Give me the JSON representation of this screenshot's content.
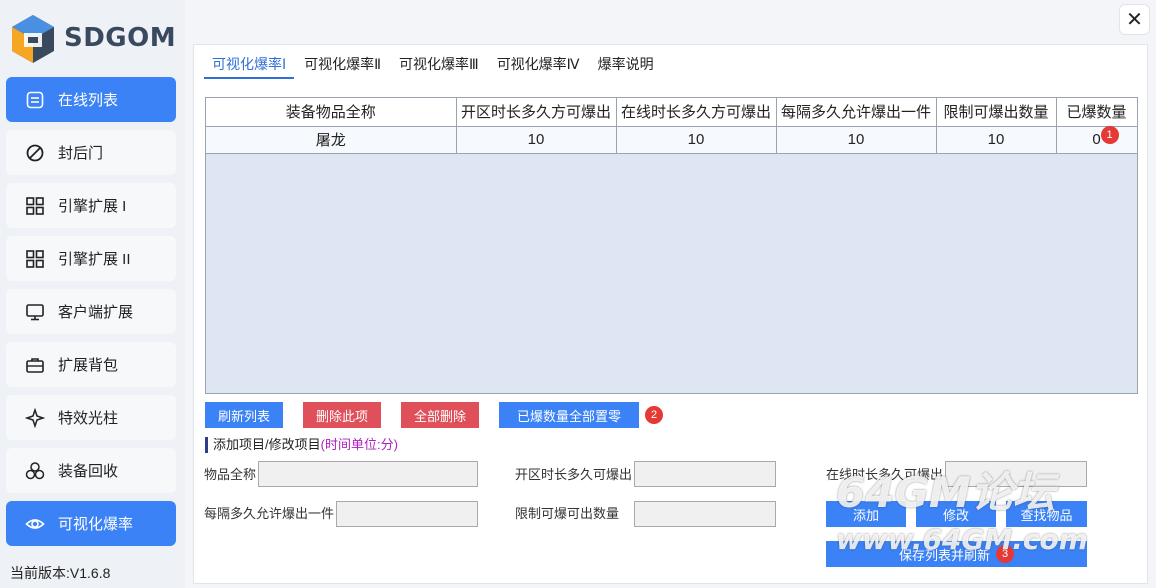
{
  "brand": {
    "name": "SDGOM"
  },
  "sidebar": {
    "items": [
      {
        "label": "在线列表",
        "icon": "list-icon",
        "active": true
      },
      {
        "label": "封后门",
        "icon": "block-icon",
        "active": false
      },
      {
        "label": "引擎扩展 I",
        "icon": "grid-icon",
        "active": false
      },
      {
        "label": "引擎扩展 II",
        "icon": "grid-icon",
        "active": false
      },
      {
        "label": "客户端扩展",
        "icon": "monitor-icon",
        "active": false
      },
      {
        "label": "扩展背包",
        "icon": "briefcase-icon",
        "active": false
      },
      {
        "label": "特效光柱",
        "icon": "sparkle-icon",
        "active": false
      },
      {
        "label": "装备回收",
        "icon": "recycle-icon",
        "active": false
      },
      {
        "label": "可视化爆率",
        "icon": "eye-icon",
        "active": true
      }
    ],
    "version": "当前版本:V1.6.8"
  },
  "window": {
    "close": "✕"
  },
  "tabs": [
    {
      "label": "可视化爆率Ⅰ",
      "active": true
    },
    {
      "label": "可视化爆率Ⅱ",
      "active": false
    },
    {
      "label": "可视化爆率Ⅲ",
      "active": false
    },
    {
      "label": "可视化爆率Ⅳ",
      "active": false
    },
    {
      "label": "爆率说明",
      "active": false
    }
  ],
  "table": {
    "headers": [
      "装备物品全称",
      "开区时长多久方可爆出",
      "在线时长多久方可爆出",
      "每隔多久允许爆出一件",
      "限制可爆出数量",
      "已爆数量"
    ],
    "rows": [
      [
        "屠龙",
        "10",
        "10",
        "10",
        "10",
        "0"
      ]
    ],
    "badge": "1"
  },
  "buttons": {
    "refresh": "刷新列表",
    "delete_item": "删除此项",
    "delete_all": "全部删除",
    "reset_count": "已爆数量全部置零",
    "badge": "2"
  },
  "form": {
    "section_title": "添加项目/修改项目",
    "section_hint": "(时间单位:分)",
    "item_name_label": "物品全称",
    "item_name_value": "",
    "open_time_label": "开区时长多久可爆出",
    "open_time_value": "",
    "online_time_label": "在线时长多久可爆出",
    "online_time_value": "",
    "interval_label": "每隔多久允许爆出一件",
    "interval_value": "",
    "limit_label": "限制可爆可出数量",
    "limit_value": "",
    "add_label": "添加",
    "modify_label": "修改",
    "find_label": "查找物品",
    "save_label": "保存列表并刷新",
    "save_badge": "3"
  },
  "watermark": {
    "line1": "64GM论坛",
    "line2": "www.64GM.com"
  }
}
